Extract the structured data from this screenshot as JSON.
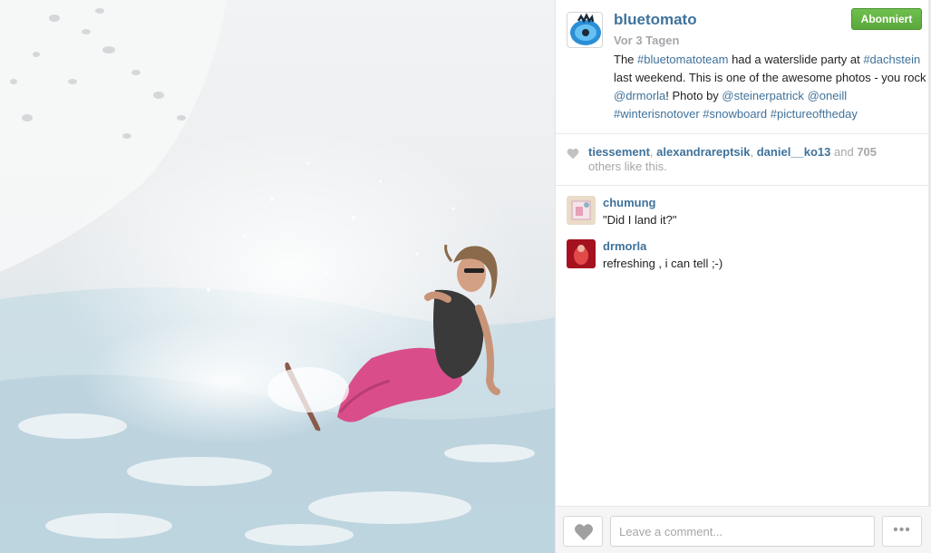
{
  "post": {
    "username": "bluetomato",
    "follow_label": "Abonniert",
    "time": "Vor 3 Tagen",
    "caption": {
      "t1": "The ",
      "tag1": "#bluetomatoteam",
      "t2": " had a waterslide party at ",
      "tag2": "#dachstein",
      "t3": " last weekend. This is one of the awesome photos - you rock ",
      "mention1": "@drmorla",
      "t4": "! Photo by ",
      "mention2": "@steinerpatrick",
      "t5": " ",
      "mention3": "@oneill",
      "t6": " ",
      "tag3": "#winterisnotover",
      "t7": " ",
      "tag4": "#snowboard",
      "t8": " ",
      "tag5": "#pictureoftheday"
    }
  },
  "likes": {
    "user1": "tiessement",
    "sep1": ", ",
    "user2": "alexandrareptsik",
    "sep2": ", ",
    "user3": "daniel__ko13",
    "and": " and ",
    "count": "705",
    "suffix": "others like this."
  },
  "comments": [
    {
      "author": "chumung",
      "text": "\"Did I land it?\""
    },
    {
      "author": "drmorla",
      "text": "refreshing , i can tell ;-)"
    }
  ],
  "footer": {
    "comment_placeholder": "Leave a comment...",
    "more_label": "•••"
  },
  "colors": {
    "link": "#3f729b",
    "follow_green": "#5aa83a",
    "muted": "#a5a7aa"
  },
  "icons": {
    "like": "heart-icon",
    "more": "ellipsis-icon"
  }
}
